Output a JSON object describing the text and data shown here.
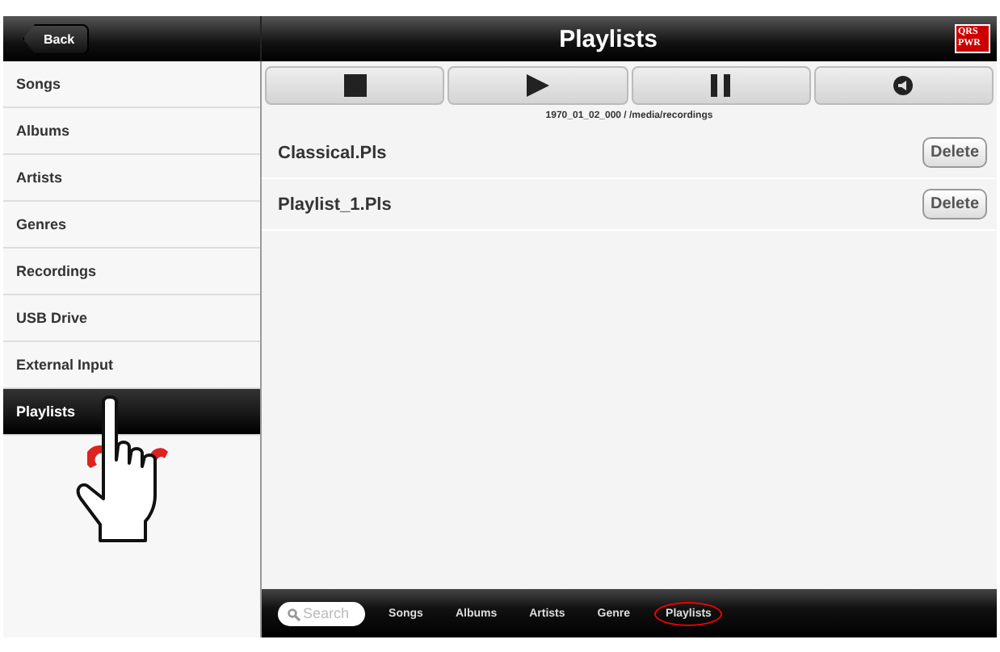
{
  "header": {
    "back": "Back",
    "title": "Playlists",
    "logo": [
      "QRS",
      "PWR"
    ]
  },
  "sidebar": {
    "items": [
      {
        "label": "Songs",
        "selected": false
      },
      {
        "label": "Albums",
        "selected": false
      },
      {
        "label": "Artists",
        "selected": false
      },
      {
        "label": "Genres",
        "selected": false
      },
      {
        "label": "Recordings",
        "selected": false
      },
      {
        "label": "USB Drive",
        "selected": false
      },
      {
        "label": "External Input",
        "selected": false
      },
      {
        "label": "Playlists",
        "selected": true
      }
    ]
  },
  "transport": {
    "buttons": [
      {
        "kind": "stop"
      },
      {
        "kind": "play"
      },
      {
        "kind": "pause"
      },
      {
        "kind": "volume"
      }
    ],
    "path": "1970_01_02_000 / /media/recordings"
  },
  "playlists": [
    {
      "name": "Classical.Pls",
      "action": "Delete"
    },
    {
      "name": "Playlist_1.Pls",
      "action": "Delete"
    }
  ],
  "bottom_bar": {
    "search": {
      "placeholder": "Search"
    },
    "tabs": [
      {
        "label": "Songs",
        "circled": false
      },
      {
        "label": "Albums",
        "circled": false
      },
      {
        "label": "Artists",
        "circled": false
      },
      {
        "label": "Genre",
        "circled": false
      },
      {
        "label": "Playlists",
        "circled": true
      }
    ]
  }
}
